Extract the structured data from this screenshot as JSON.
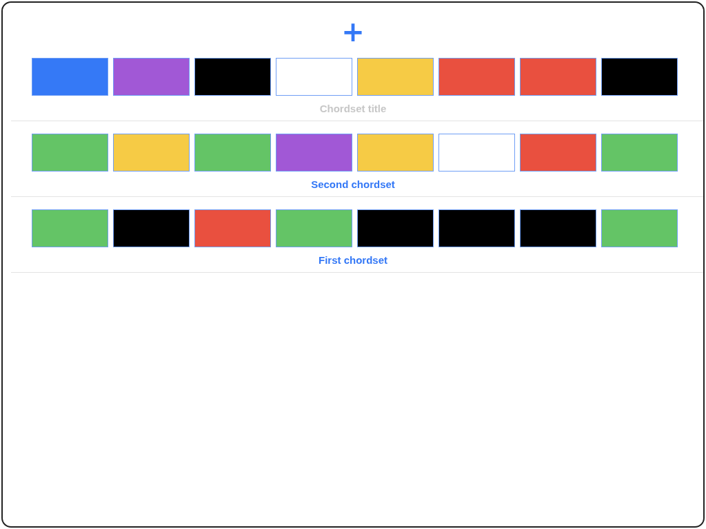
{
  "add_button": {
    "label": "+"
  },
  "chordsets": [
    {
      "placeholder": "Chordset title",
      "chords": [
        {
          "color": "#3579f6"
        },
        {
          "color": "#a158d6"
        },
        {
          "color": "#000000"
        },
        {
          "color": "#ffffff"
        },
        {
          "color": "#f6cb45"
        },
        {
          "color": "#e9503f"
        },
        {
          "color": "#e9503f"
        },
        {
          "color": "#000000"
        }
      ]
    },
    {
      "title": "Second chordset",
      "chords": [
        {
          "color": "#64c466"
        },
        {
          "color": "#f6cb45"
        },
        {
          "color": "#64c466"
        },
        {
          "color": "#a158d6"
        },
        {
          "color": "#f6cb45"
        },
        {
          "color": "#ffffff"
        },
        {
          "color": "#e9503f"
        },
        {
          "color": "#64c466"
        }
      ]
    },
    {
      "title": "First chordset",
      "chords": [
        {
          "color": "#64c466"
        },
        {
          "color": "#000000"
        },
        {
          "color": "#e9503f"
        },
        {
          "color": "#64c466"
        },
        {
          "color": "#000000"
        },
        {
          "color": "#000000"
        },
        {
          "color": "#000000"
        },
        {
          "color": "#64c466"
        }
      ]
    }
  ]
}
